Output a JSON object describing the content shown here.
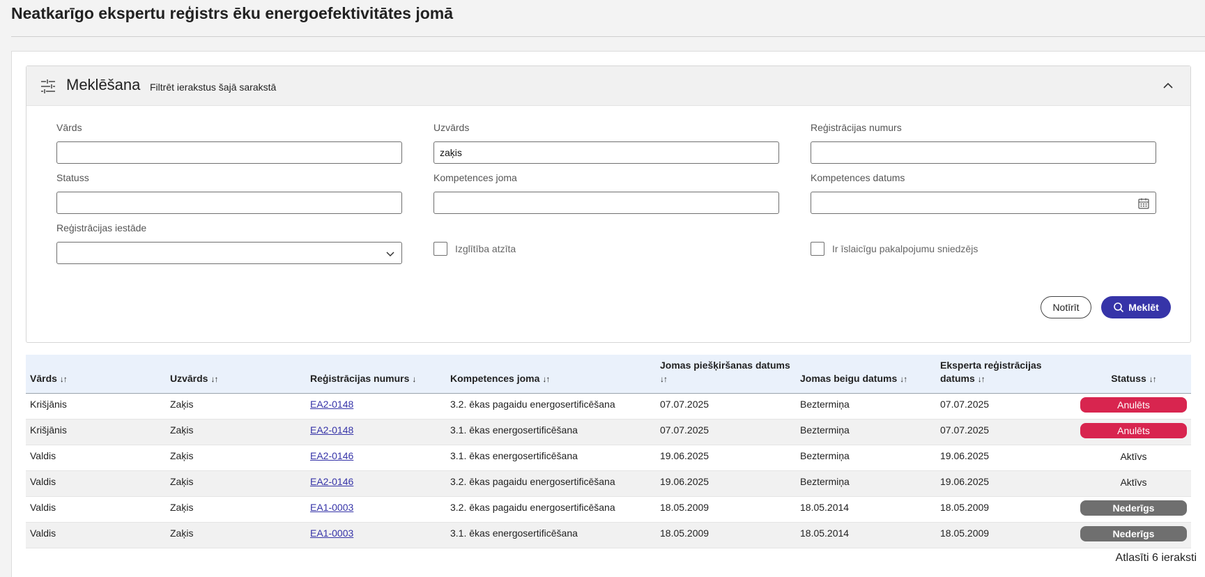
{
  "page": {
    "title": "Neatkarīgo ekspertu reģistrs ēku energoefektivitātes jomā"
  },
  "search": {
    "title": "Meklēšana",
    "subtitle": "Filtrēt ierakstus šajā sarakstā",
    "fields": {
      "first_name": {
        "label": "Vārds",
        "value": ""
      },
      "last_name": {
        "label": "Uzvārds",
        "value": "zaķis"
      },
      "reg_number": {
        "label": "Reģistrācijas numurs",
        "value": ""
      },
      "status": {
        "label": "Statuss",
        "value": ""
      },
      "competence_area": {
        "label": "Kompetences joma",
        "value": ""
      },
      "competence_date": {
        "label": "Kompetences datums",
        "value": ""
      },
      "reg_institution": {
        "label": "Reģistrācijas iestāde",
        "value": ""
      }
    },
    "checkboxes": {
      "education_recognized": {
        "label": "Izglītība atzīta",
        "checked": false
      },
      "temporary_provider": {
        "label": "Ir īslaicīgu pakalpojumu sniedzējs",
        "checked": false
      }
    },
    "buttons": {
      "clear": "Notīrīt",
      "search": "Meklēt"
    },
    "icons": {
      "filter": "sliders-icon",
      "collapse": "chevron-up-icon",
      "calendar": "calendar-icon",
      "select": "chevron-down-icon",
      "search": "search-icon"
    }
  },
  "table": {
    "headers": {
      "first_name": "Vārds",
      "last_name": "Uzvārds",
      "reg_number": "Reģistrācijas numurs",
      "competence_area": "Kompetences joma",
      "assign_date": "Jomas piešķiršanas datums",
      "end_date": "Jomas beigu datums",
      "expert_reg_date": "Eksperta reģistrācijas datums",
      "status": "Statuss"
    },
    "sort_icons": {
      "first_name": "↓↑",
      "last_name": "↓↑",
      "reg_number": "↓",
      "competence_area": "↓↑",
      "assign_date": "↓↑",
      "end_date": "↓↑",
      "expert_reg_date": "↓↑",
      "status": "↓↑"
    },
    "rows": [
      {
        "first_name": "Krišjānis",
        "last_name": "Zaķis",
        "reg_number": "EA2-0148",
        "competence_area": "3.2. ēkas pagaidu energosertificēšana",
        "assign_date": "07.07.2025",
        "end_date": "Beztermiņa",
        "expert_reg_date": "07.07.2025",
        "status": "Anulēts"
      },
      {
        "first_name": "Krišjānis",
        "last_name": "Zaķis",
        "reg_number": "EA2-0148",
        "competence_area": "3.1. ēkas energosertificēšana",
        "assign_date": "07.07.2025",
        "end_date": "Beztermiņa",
        "expert_reg_date": "07.07.2025",
        "status": "Anulēts"
      },
      {
        "first_name": "Valdis",
        "last_name": "Zaķis",
        "reg_number": "EA2-0146",
        "competence_area": "3.1. ēkas energosertificēšana",
        "assign_date": "19.06.2025",
        "end_date": "Beztermiņa",
        "expert_reg_date": "19.06.2025",
        "status": "Aktīvs"
      },
      {
        "first_name": "Valdis",
        "last_name": "Zaķis",
        "reg_number": "EA2-0146",
        "competence_area": "3.2. ēkas pagaidu energosertificēšana",
        "assign_date": "19.06.2025",
        "end_date": "Beztermiņa",
        "expert_reg_date": "19.06.2025",
        "status": "Aktīvs"
      },
      {
        "first_name": "Valdis",
        "last_name": "Zaķis",
        "reg_number": "EA1-0003",
        "competence_area": "3.2. ēkas pagaidu energosertificēšana",
        "assign_date": "18.05.2009",
        "end_date": "18.05.2014",
        "expert_reg_date": "18.05.2009",
        "status": "Nederīgs"
      },
      {
        "first_name": "Valdis",
        "last_name": "Zaķis",
        "reg_number": "EA1-0003",
        "competence_area": "3.1. ēkas energosertificēšana",
        "assign_date": "18.05.2009",
        "end_date": "18.05.2014",
        "expert_reg_date": "18.05.2009",
        "status": "Nederīgs"
      }
    ],
    "status_colors": {
      "Anulēts": "#d8254f",
      "Nederīgs": "#6f6f6f",
      "Aktīvs": "transparent"
    },
    "results_count": "Atlasīti 6 ieraksti"
  },
  "colors": {
    "primary": "#3634a8",
    "link": "#3634a8",
    "header_bg": "#eaf1fb"
  }
}
